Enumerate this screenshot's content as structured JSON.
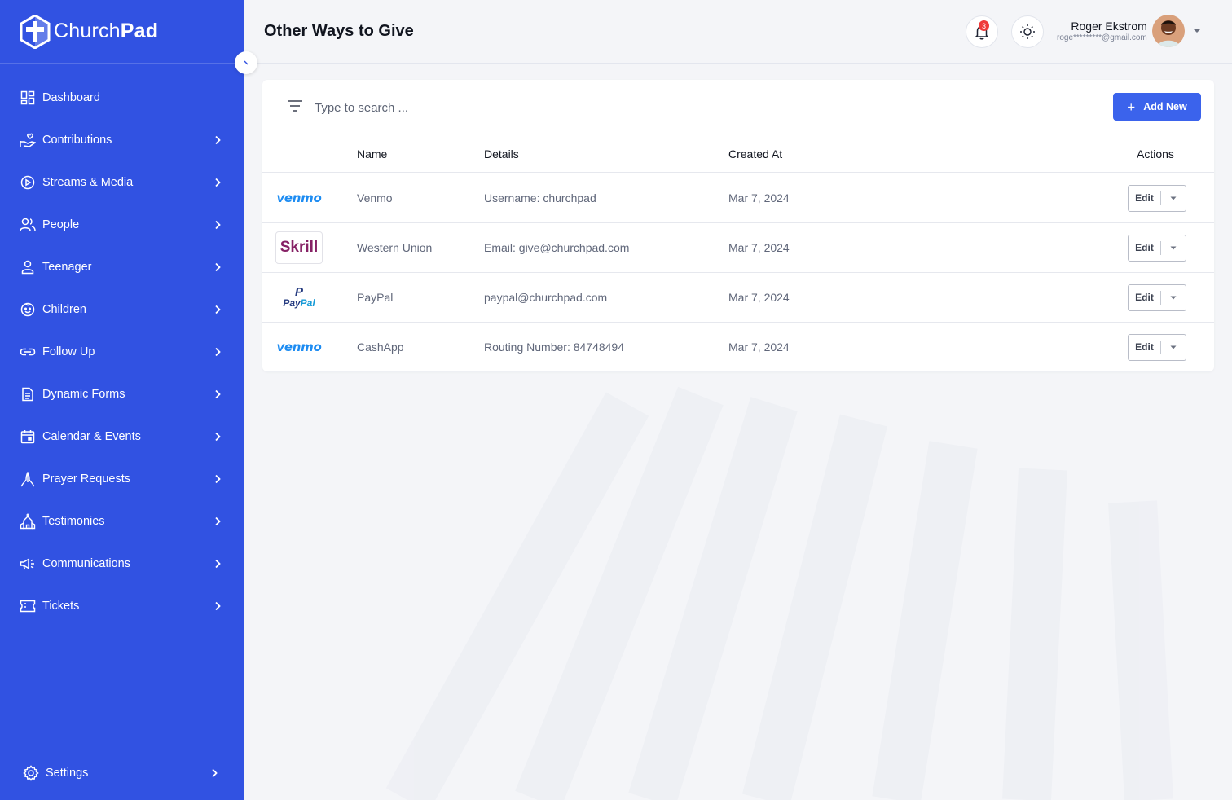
{
  "brand": {
    "name_light": "Church",
    "name_bold": "Pad"
  },
  "sidebar": {
    "items": [
      {
        "label": "Dashboard",
        "icon": "dashboard-icon",
        "chevron": false
      },
      {
        "label": "Contributions",
        "icon": "hand-heart-icon",
        "chevron": true
      },
      {
        "label": "Streams & Media",
        "icon": "play-circle-icon",
        "chevron": true
      },
      {
        "label": "People",
        "icon": "users-icon",
        "chevron": true
      },
      {
        "label": "Teenager",
        "icon": "user-icon",
        "chevron": true
      },
      {
        "label": "Children",
        "icon": "child-face-icon",
        "chevron": true
      },
      {
        "label": "Follow Up",
        "icon": "link-icon",
        "chevron": true
      },
      {
        "label": "Dynamic Forms",
        "icon": "document-icon",
        "chevron": true
      },
      {
        "label": "Calendar & Events",
        "icon": "calendar-icon",
        "chevron": true
      },
      {
        "label": "Prayer Requests",
        "icon": "praying-hands-icon",
        "chevron": true
      },
      {
        "label": "Testimonies",
        "icon": "church-icon",
        "chevron": true
      },
      {
        "label": "Communications",
        "icon": "megaphone-icon",
        "chevron": true
      },
      {
        "label": "Tickets",
        "icon": "ticket-icon",
        "chevron": true
      }
    ],
    "settings_label": "Settings"
  },
  "header": {
    "title": "Other Ways to Give",
    "notification_count": "3",
    "user_name": "Roger Ekstrom",
    "user_email": "roge*********@gmail.com"
  },
  "search": {
    "placeholder": "Type to search ..."
  },
  "add_button": {
    "label": "Add New"
  },
  "table": {
    "columns": {
      "name": "Name",
      "details": "Details",
      "created": "Created At",
      "actions": "Actions"
    },
    "rows": [
      {
        "logo": "venmo",
        "logo_text": "venmo",
        "name": "Venmo",
        "details": "Username: churchpad",
        "created": "Mar 7, 2024",
        "action": "Edit"
      },
      {
        "logo": "skrill",
        "logo_text": "Skrill",
        "name": "Western Union",
        "details": "Email: give@churchpad.com",
        "created": "Mar 7, 2024",
        "action": "Edit"
      },
      {
        "logo": "paypal",
        "logo_text": "PayPal",
        "name": "PayPal",
        "details": "paypal@churchpad.com",
        "created": "Mar 7, 2024",
        "action": "Edit"
      },
      {
        "logo": "venmo",
        "logo_text": "venmo",
        "name": "CashApp",
        "details": "Routing Number: 84748494",
        "created": "Mar 7, 2024",
        "action": "Edit"
      }
    ]
  },
  "colors": {
    "sidebar": "#3152e2",
    "accent": "#3b63ec",
    "badge": "#ef3b3b"
  }
}
